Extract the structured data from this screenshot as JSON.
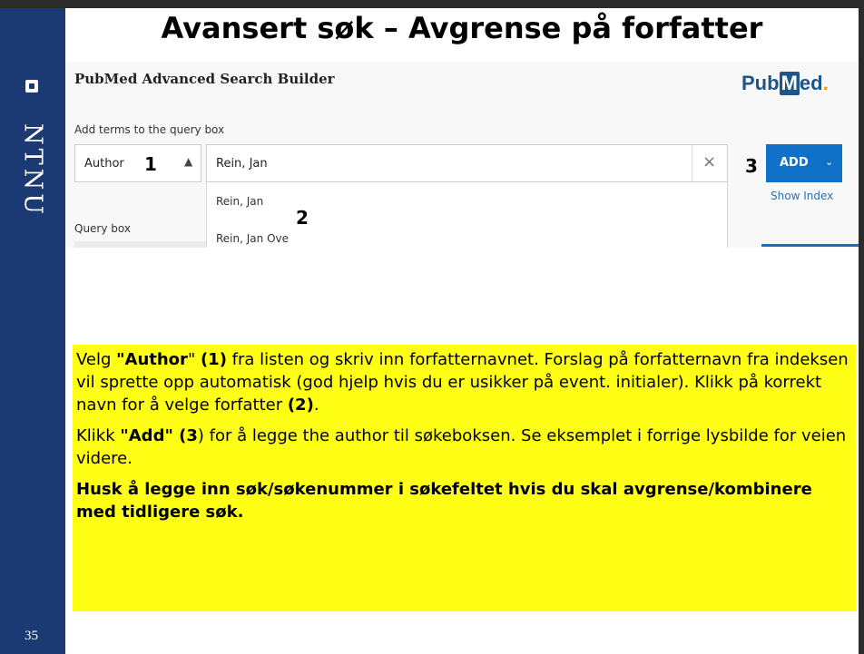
{
  "slide": {
    "title": "Avansert søk – Avgrense på forfatter",
    "slide_number": "35",
    "logo_text": "NTNU"
  },
  "screenshot": {
    "header": "PubMed Advanced Search Builder",
    "logo": {
      "pre": "Pub",
      "mark": "M",
      "post": "ed",
      "dot": "."
    },
    "add_terms_label": "Add terms to the query box",
    "field_select_value": "Author",
    "search_value": "Rein, Jan",
    "clear_glyph": "×",
    "add_button_label": "ADD",
    "add_caret": "⌄",
    "show_index_label": "Show Index",
    "suggestions": [
      "Rein, Jan",
      "Rein, Jan Ove"
    ],
    "query_box_label": "Query box"
  },
  "annotations": {
    "one": "1",
    "two": "2",
    "three": "3"
  },
  "instructions": {
    "p1": {
      "a": "Velg ",
      "b": "\"Author",
      "c": "\" ",
      "d": "(1)",
      "e": " fra listen og skriv inn forfatternavnet. Forslag på forfatternavn fra indeksen vil sprette opp automatisk (god hjelp hvis du er usikker på event. initialer). Klikk på korrekt navn for å velge forfatter ",
      "f": "(2)",
      "g": "."
    },
    "p2": {
      "a": "Klikk ",
      "b": "\"Add\" (3",
      "c": ") for å legge the author til søkeboksen. Se eksemplet i forrige lysbilde for veien videre."
    },
    "p3": "Husk å legge inn søk/søkenummer i søkefeltet hvis du skal avgrense/kombinere med tidligere søk."
  },
  "colors": {
    "sidebar": "#1b3a73",
    "highlight": "#ffff16",
    "add_button": "#1170c8",
    "pubmed_brand": "#20558a"
  }
}
